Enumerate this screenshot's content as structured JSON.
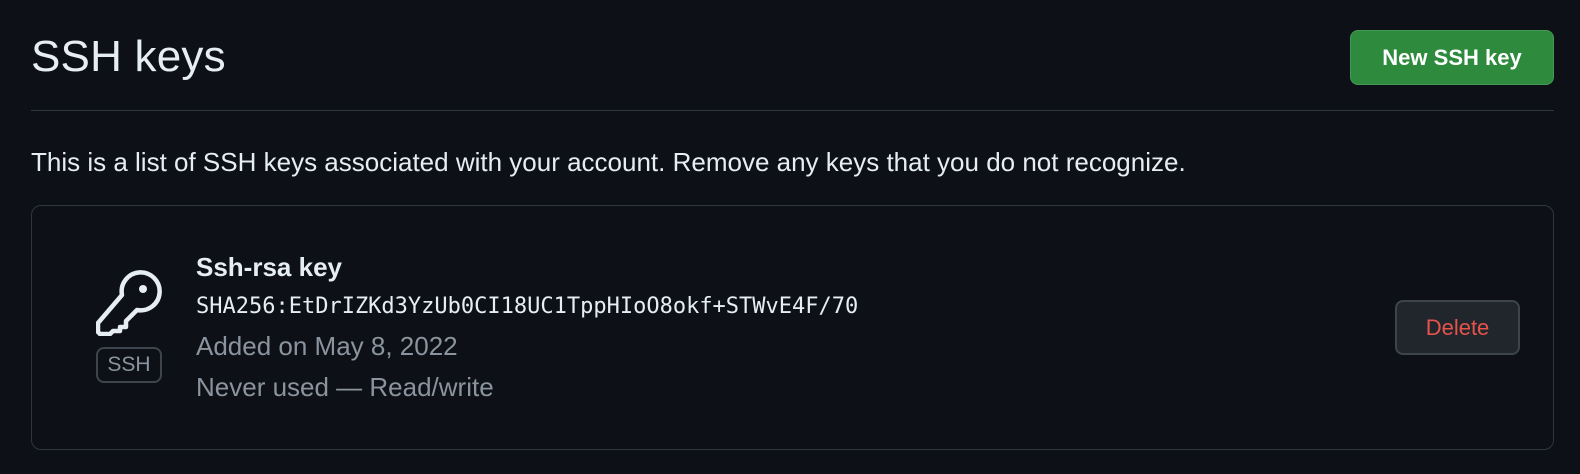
{
  "header": {
    "title": "SSH keys",
    "new_key_label": "New SSH key"
  },
  "intro_text": "This is a list of SSH keys associated with your account. Remove any keys that you do not recognize.",
  "keys": [
    {
      "title": "Ssh-rsa key",
      "fingerprint": "SHA256:EtDrIZKd3YzUb0CI18UC1TppHIoO8okf+STWvE4F/70",
      "added": "Added on May 8, 2022",
      "usage": "Never used — Read/write",
      "badge": "SSH",
      "icon": "key-icon",
      "delete_label": "Delete"
    }
  ],
  "colors": {
    "background": "#0d1117",
    "primary_button": "#2e8b3d",
    "danger_text": "#e5534b",
    "border": "#30363d",
    "muted_text": "#8b949e"
  }
}
